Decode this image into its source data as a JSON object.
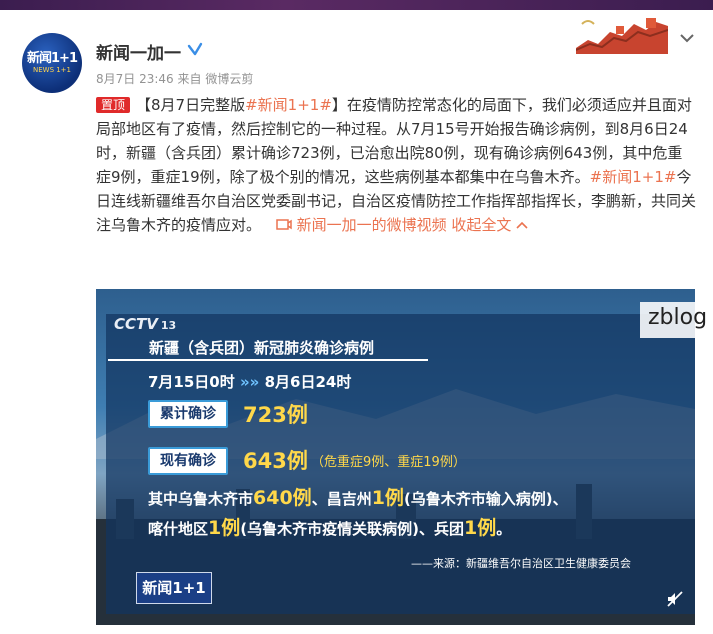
{
  "post": {
    "author": "新闻一加一",
    "avatar_text": "新闻1+1",
    "avatar_sub": "NEWS 1+1",
    "time": "8月7日 23:46",
    "source_prefix": "来自",
    "source": "微博云剪",
    "pinned_label": "置顶",
    "text_prefix": "【8月7日完整版",
    "hashtag": "#新闻1+1#",
    "text_part1": "】在疫情防控常态化的局面下，我们必须适应并且面对局部地区有了疫情，然后控制它的一种过程。从7月15号开始报告确诊病例，到8月6日24时，新疆（含兵团）累计确诊723例，已治愈出院80例，现有确诊病例643例，其中危重症9例，重症19例，除了极个别的情况，这些病例基本都集中在乌鲁木齐。",
    "hashtag2": "#新闻1+1#",
    "text_part2": "今日连线新疆维吾尔自治区党委副书记，自治区疫情防控工作指挥部指挥长，李鹏新，共同关注乌鲁木齐的疫情应对。",
    "video_link": "新闻一加一的微博视频",
    "collapse_label": "收起全文"
  },
  "video": {
    "channel": "CCTV",
    "channel_num": "13",
    "title": "新疆（含兵团）新冠肺炎确诊病例",
    "date_from": "7月15日0时",
    "arrows": "»»",
    "date_to": "8月6日24时",
    "cumulative_label": "累计确诊",
    "cumulative_value": "723例",
    "current_label": "现有确诊",
    "current_value": "643例",
    "current_detail": "（危重症9例、重症19例）",
    "line1_a": "其中乌鲁木齐市",
    "line1_num1": "640例",
    "line1_b": "、昌吉州",
    "line1_num2": "1例",
    "line1_c": "(乌鲁木齐市输入病例)、",
    "line2_a": "喀什地区",
    "line2_num1": "1例",
    "line2_b": "(乌鲁木齐市疫情关联病例)、兵团",
    "line2_num2": "1例",
    "line2_c": "。",
    "source": "——来源：新疆维吾尔自治区卫生健康委员会",
    "logo": "新闻1+1"
  },
  "watermark": "zblog",
  "colors": {
    "accent": "#eb7350",
    "pin": "#e02a2a",
    "verified": "#3a8ee6"
  }
}
